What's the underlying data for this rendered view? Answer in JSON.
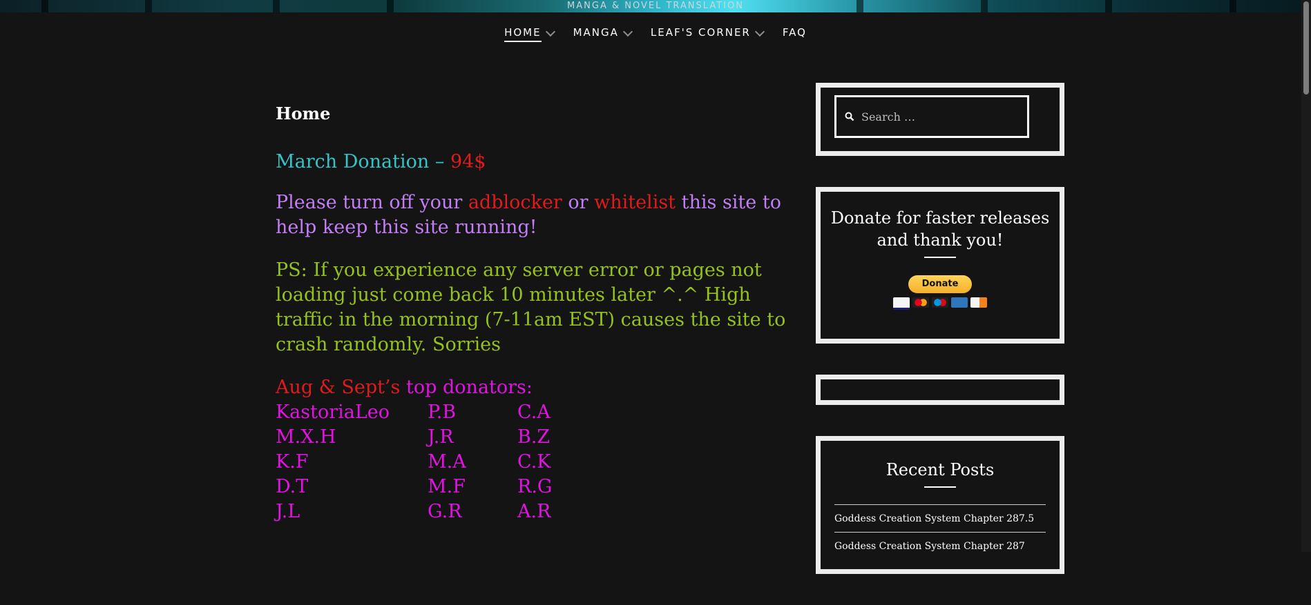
{
  "header": {
    "tagline": "MANGA & NOVEL TRANSLATION"
  },
  "nav": {
    "items": [
      {
        "label": "HOME",
        "dropdown": true,
        "active": true
      },
      {
        "label": "MANGA",
        "dropdown": true
      },
      {
        "label": "LEAF'S CORNER",
        "dropdown": true
      },
      {
        "label": "FAQ",
        "dropdown": false
      }
    ]
  },
  "main": {
    "page_title": "Home",
    "donation": {
      "label": "March Donation",
      "separator": " – ",
      "amount": "94$"
    },
    "adblock": {
      "part1": "Please turn off your ",
      "adblocker": "adblocker",
      "part2": " or ",
      "whitelist": "whitelist",
      "part3": " this site to help keep this site running!"
    },
    "ps_notice": "PS: If you experience any server error or pages not loading just come back 10 minutes later ^.^ High traffic in the morning (7-11am EST) causes the site to crash randomly. Sorries",
    "donators": {
      "months": "Aug & Sept’s",
      "heading": " top donators:",
      "rows": [
        [
          "KastoriaLeo",
          "P.B",
          "C.A"
        ],
        [
          "M.X.H",
          "J.R",
          "B.Z"
        ],
        [
          "K.F",
          "M.A",
          "C.K"
        ],
        [
          "D.T",
          "M.F",
          "R.G"
        ],
        [
          "J.L",
          "G.R",
          "A.R"
        ]
      ]
    }
  },
  "sidebar": {
    "search": {
      "placeholder": "Search …"
    },
    "donate": {
      "title": "Donate for faster releases and thank you!",
      "button_label": "Donate"
    },
    "recent_posts": {
      "title": "Recent Posts",
      "items": [
        "Goddess Creation System Chapter 287.5",
        "Goddess Creation System Chapter 287"
      ]
    }
  },
  "colors": {
    "background": "#141414",
    "donation_teal": "#35c3c4",
    "highlight_red": "#e01b1b",
    "adblock_purple": "#c27ef5",
    "ps_olive": "#95c21c",
    "donators_magenta": "#e212e2"
  }
}
